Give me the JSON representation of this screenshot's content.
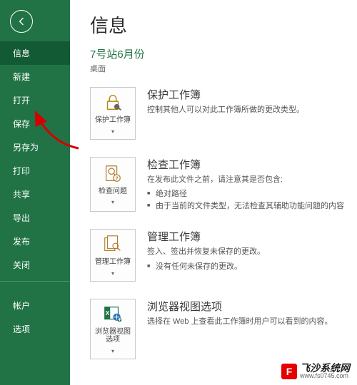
{
  "sidebar": {
    "items": [
      {
        "label": "信息",
        "sel": true
      },
      {
        "label": "新建"
      },
      {
        "label": "打开"
      },
      {
        "label": "保存"
      },
      {
        "label": "另存为"
      },
      {
        "label": "打印"
      },
      {
        "label": "共享"
      },
      {
        "label": "导出"
      },
      {
        "label": "发布"
      },
      {
        "label": "关闭"
      }
    ],
    "footer": [
      {
        "label": "帐户"
      },
      {
        "label": "选项"
      }
    ]
  },
  "main": {
    "title": "信息",
    "docName": "7号站6月份",
    "location": "桌面",
    "sections": [
      {
        "btn": "保护工作簿",
        "icon": "protect",
        "heading": "保护工作簿",
        "desc": "控制其他人可以对此工作簿所做的更改类型。"
      },
      {
        "btn": "检查问题",
        "icon": "inspect",
        "heading": "检查工作簿",
        "desc": "在发布此文件之前，请注意其是否包含:",
        "bullets": [
          "绝对路径",
          "由于当前的文件类型，无法检查其辅助功能问题的内容"
        ]
      },
      {
        "btn": "管理工作簿",
        "icon": "manage",
        "heading": "管理工作簿",
        "desc": "签入、签出并恢复未保存的更改。",
        "bullets": [
          "没有任何未保存的更改。"
        ]
      },
      {
        "btn": "浏览器视图选项",
        "icon": "browser",
        "heading": "浏览器视图选项",
        "desc": "选择在 Web 上查看此工作簿时用户可以看到的内容。"
      }
    ]
  },
  "watermark": {
    "name": "飞沙系统网",
    "url": "www.fs0745.com"
  }
}
